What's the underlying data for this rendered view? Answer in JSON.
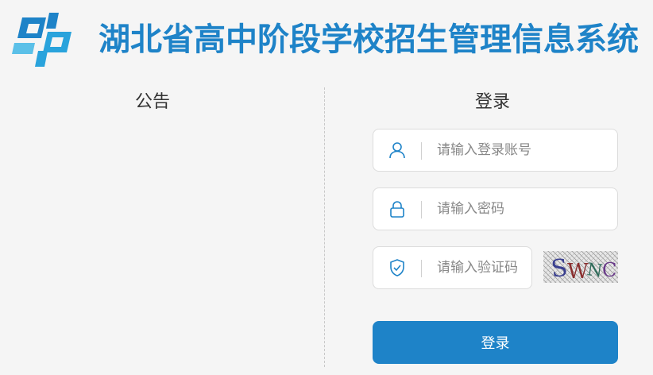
{
  "header": {
    "title": "湖北省高中阶段学校招生管理信息系统",
    "brand_color": "#1e83c8"
  },
  "notice": {
    "title": "公告"
  },
  "login": {
    "title": "登录",
    "username": {
      "placeholder": "请输入登录账号",
      "value": "",
      "icon": "user-icon"
    },
    "password": {
      "placeholder": "请输入密码",
      "value": "",
      "icon": "lock-icon"
    },
    "captcha": {
      "placeholder": "请输入验证码",
      "value": "",
      "icon": "shield-check-icon",
      "image_text": "SWNC"
    },
    "submit_label": "登录"
  }
}
